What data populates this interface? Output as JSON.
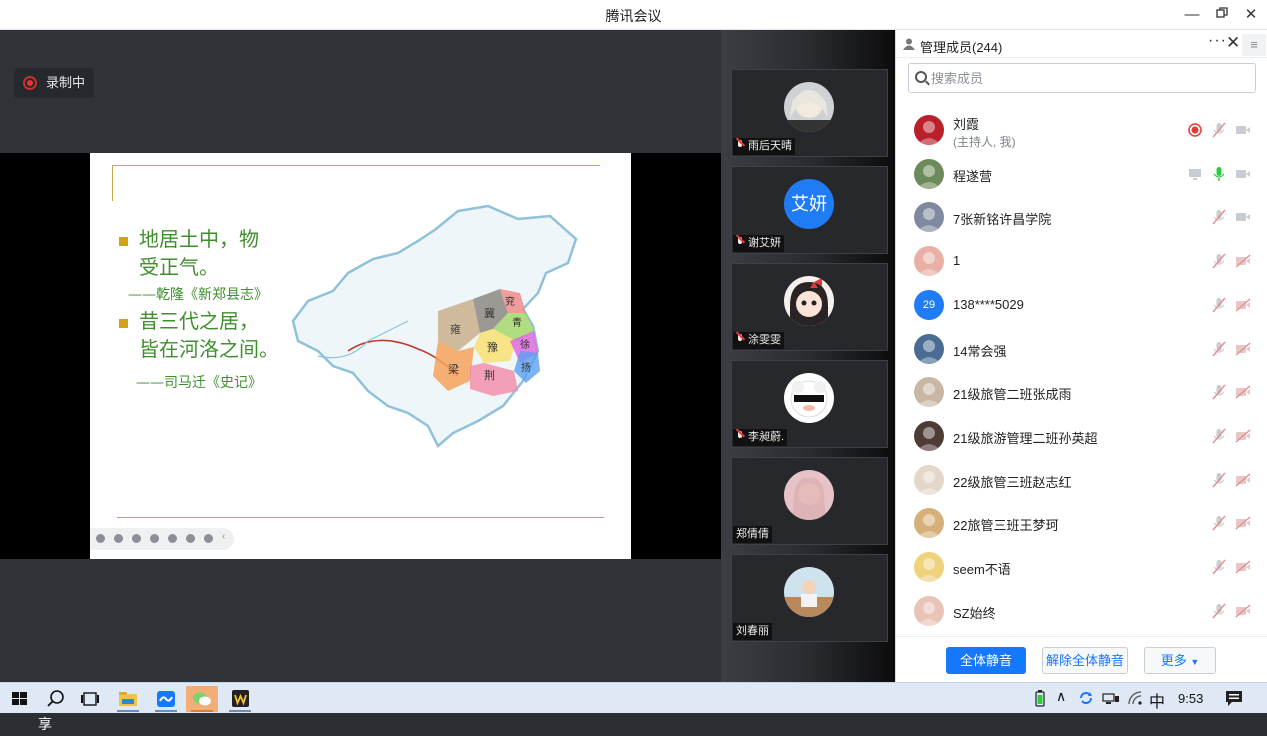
{
  "window": {
    "title": "腾讯会议"
  },
  "recording": {
    "label": "录制中"
  },
  "slide": {
    "line1": "地居土中，物",
    "line2": "受正气。",
    "cite1": "——乾隆《新郑县志》",
    "line3": "昔三代之居，",
    "line4": "皆在河洛之间。",
    "cite2": "——司马迁《史记》",
    "map_labels": [
      "雍",
      "冀",
      "兖",
      "青",
      "豫",
      "徐",
      "梁",
      "荆",
      "扬"
    ]
  },
  "screen_share": {
    "label": "程遂营的屏幕共享"
  },
  "video_tiles": [
    {
      "name": "雨后天晴",
      "muted": true
    },
    {
      "name": "谢艾妍",
      "muted": true,
      "avatar_text": "艾妍"
    },
    {
      "name": "涂雯雯",
      "muted": true
    },
    {
      "name": "李昶蔚.",
      "muted": true
    },
    {
      "name": "郑倩倩",
      "muted": false
    },
    {
      "name": "刘春丽",
      "muted": false
    }
  ],
  "panel": {
    "title": "管理成员(244)",
    "search_placeholder": "搜索成员",
    "members": [
      {
        "name": "刘霞",
        "sub": "(主持人, 我)"
      },
      {
        "name": "程遂营"
      },
      {
        "name": "7张新铭许昌学院"
      },
      {
        "name": "1"
      },
      {
        "name": "138****5029",
        "avatar_text": "29"
      },
      {
        "name": "14常会强"
      },
      {
        "name": "21级旅管二班张成雨"
      },
      {
        "name": "21级旅游管理二班孙英超"
      },
      {
        "name": "22级旅管三班赵志红"
      },
      {
        "name": "22旅管三班王梦珂"
      },
      {
        "name": "seem不语"
      },
      {
        "name": "SZ始终"
      }
    ],
    "buttons": {
      "mute_all": "全体静音",
      "unmute_all": "解除全体静音",
      "more": "更多"
    }
  },
  "taskbar": {
    "ime": "中",
    "time": "9:53"
  },
  "colors": {
    "accent": "#1677ff",
    "slide_text": "#3f8f2e",
    "rec_red": "#e53935"
  }
}
